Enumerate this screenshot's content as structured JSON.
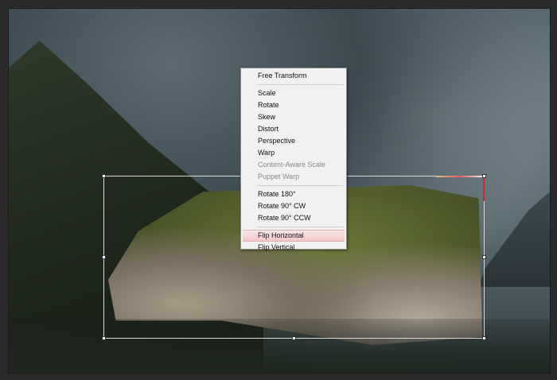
{
  "context_menu": {
    "items": [
      {
        "label": "Free Transform",
        "enabled": true
      },
      {
        "label": "Scale",
        "enabled": true
      },
      {
        "label": "Rotate",
        "enabled": true
      },
      {
        "label": "Skew",
        "enabled": true
      },
      {
        "label": "Distort",
        "enabled": true
      },
      {
        "label": "Perspective",
        "enabled": true
      },
      {
        "label": "Warp",
        "enabled": true
      },
      {
        "label": "Content-Aware Scale",
        "enabled": false
      },
      {
        "label": "Puppet Warp",
        "enabled": false
      },
      {
        "label": "Rotate 180°",
        "enabled": true
      },
      {
        "label": "Rotate 90° CW",
        "enabled": true
      },
      {
        "label": "Rotate 90° CCW",
        "enabled": true
      },
      {
        "label": "Flip Horizontal",
        "enabled": true,
        "highlighted": true
      },
      {
        "label": "Flip Vertical",
        "enabled": true
      }
    ]
  },
  "colors": {
    "menu_background": "#f1f1f1",
    "menu_highlight": "#f2c7c7",
    "disabled_text": "#8a8a8a",
    "transform_box": "#d8d8d8"
  }
}
